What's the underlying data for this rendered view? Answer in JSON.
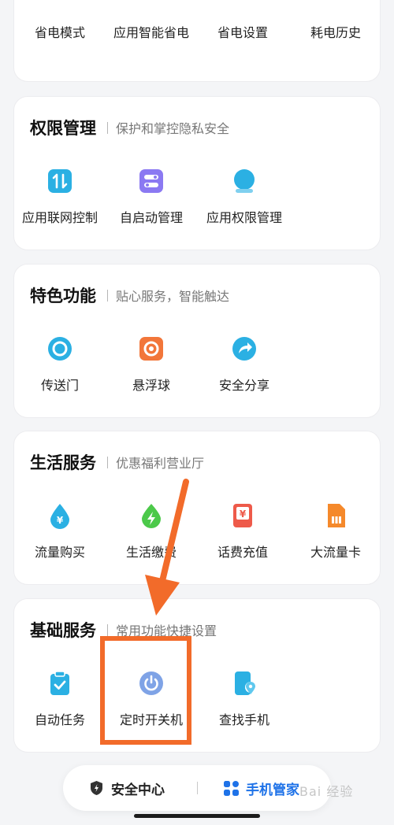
{
  "top_card": {
    "items": [
      "省电模式",
      "应用智能省电",
      "省电设置",
      "耗电历史"
    ]
  },
  "permissions": {
    "title": "权限管理",
    "subtitle": "保护和掌控隐私安全",
    "items": [
      {
        "label": "应用联网控制",
        "icon": "network-toggle-icon"
      },
      {
        "label": "自启动管理",
        "icon": "autostart-icon"
      },
      {
        "label": "应用权限管理",
        "icon": "permission-icon"
      }
    ]
  },
  "features": {
    "title": "特色功能",
    "subtitle": "贴心服务，智能触达",
    "items": [
      {
        "label": "传送门",
        "icon": "portal-icon"
      },
      {
        "label": "悬浮球",
        "icon": "floating-ball-icon"
      },
      {
        "label": "安全分享",
        "icon": "share-icon"
      }
    ]
  },
  "life": {
    "title": "生活服务",
    "subtitle": "优惠福利营业厅",
    "items": [
      {
        "label": "流量购买",
        "icon": "data-purchase-icon"
      },
      {
        "label": "生活缴费",
        "icon": "utility-payment-icon"
      },
      {
        "label": "话费充值",
        "icon": "phone-recharge-icon"
      },
      {
        "label": "大流量卡",
        "icon": "sim-card-icon"
      }
    ]
  },
  "basic": {
    "title": "基础服务",
    "subtitle": "常用功能快捷设置",
    "items": [
      {
        "label": "自动任务",
        "icon": "auto-task-icon"
      },
      {
        "label": "定时开关机",
        "icon": "power-schedule-icon"
      },
      {
        "label": "查找手机",
        "icon": "find-phone-icon"
      }
    ]
  },
  "bottom_nav": {
    "security_label": "安全中心",
    "manager_label": "手机管家",
    "active": "手机管家"
  },
  "watermark": "Bai 经验",
  "colors": {
    "accent_blue": "#1e72e8",
    "annotation_orange": "#f26b2a"
  }
}
